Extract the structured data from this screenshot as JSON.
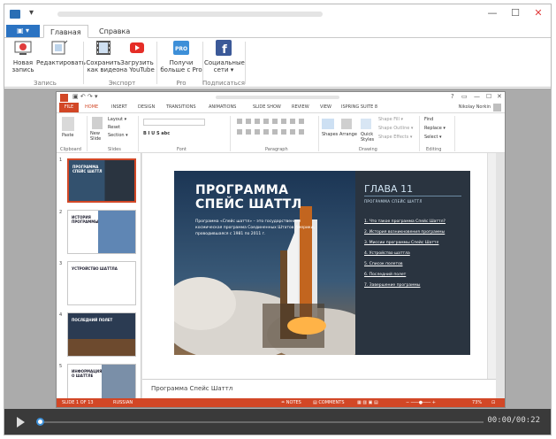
{
  "window": {
    "qa_icon": "quick-access-arrow",
    "min": "—",
    "max": "☐",
    "close": "✕"
  },
  "ribbon": {
    "file_label": "▣ ▾",
    "tabs": [
      "Главная",
      "Справка"
    ],
    "buttons": {
      "new_record": "Новая\nзапись",
      "edit": "Редактировать",
      "save_video": "Сохранить\nкак видео",
      "upload_youtube": "Загрузить\nна YouTube",
      "get_pro": "Получи\nбольше с Pro",
      "social": "Социальные\nсети ▾"
    },
    "groups": {
      "record": "Запись",
      "export": "Экспорт",
      "pro": "Pro",
      "subscribe": "Подписаться"
    }
  },
  "ppt": {
    "tabs": [
      "FILE",
      "HOME",
      "INSERT",
      "DESIGN",
      "TRANSITIONS",
      "ANIMATIONS",
      "SLIDE SHOW",
      "REVIEW",
      "VIEW",
      "ISPRING SUITE 8"
    ],
    "user": "Nikolay Norkin",
    "ribbon_items": {
      "paste": "Paste",
      "new_slide": "New\nSlide",
      "layout": "Layout ▾",
      "reset": "Reset",
      "section": "Section ▾",
      "font_row": "B  I  U  S  abc",
      "shapes": "Shapes",
      "arrange": "Arrange",
      "quick_styles": "Quick\nStyles",
      "shape_fill": "Shape Fill ▾",
      "shape_outline": "Shape Outline ▾",
      "shape_effects": "Shape Effects ▾",
      "find": "Find",
      "replace": "Replace ▾",
      "select": "Select ▾"
    },
    "groups": [
      "Clipboard",
      "Slides",
      "Font",
      "Paragraph",
      "Drawing",
      "Editing"
    ],
    "thumbs": [
      {
        "num": "1",
        "text": "ПРОГРАММА\nСПЕЙС ШАТТЛ"
      },
      {
        "num": "2",
        "text": "ИСТОРИЯ\nПРОГРАММЫ"
      },
      {
        "num": "3",
        "text": "УСТРОЙСТВО ШАТТЛА"
      },
      {
        "num": "4",
        "text": "ПОСЛЕДНИЙ ПОЛЕТ"
      },
      {
        "num": "5",
        "text": "ИНФОРМАЦИЯ\nО ШАТТЛЕ"
      }
    ],
    "slide": {
      "title": "ПРОГРАММА\nСПЕЙС ШАТТЛ",
      "desc": "Программа «Спейс шаттл» – это государственная космическая программа Соединенных Штатов Америки, проводившаяся с 1981 по 2011 г.",
      "chapter": "ГЛАВА 11",
      "chapter_sub": "ПРОГРАММА СПЕЙС ШАТТЛ",
      "toc": [
        "1. Что такое программа Спейс Шаттл?",
        "2. История возникновения программы",
        "3. Миссии программы Спейс Шаттл",
        "4. Устройство шаттла",
        "5. Список полетов",
        "6. Последний полет",
        "7. Завершение программы"
      ]
    },
    "notes": "Программа Спейс Шаттл",
    "status": {
      "slide": "SLIDE 1 OF 13",
      "lang": "RUSSIAN",
      "notes": "≐ NOTES",
      "comments": "▤ COMMENTS",
      "zoom": "73%"
    }
  },
  "player": {
    "progress": 0,
    "time": "00:00/00:22"
  }
}
